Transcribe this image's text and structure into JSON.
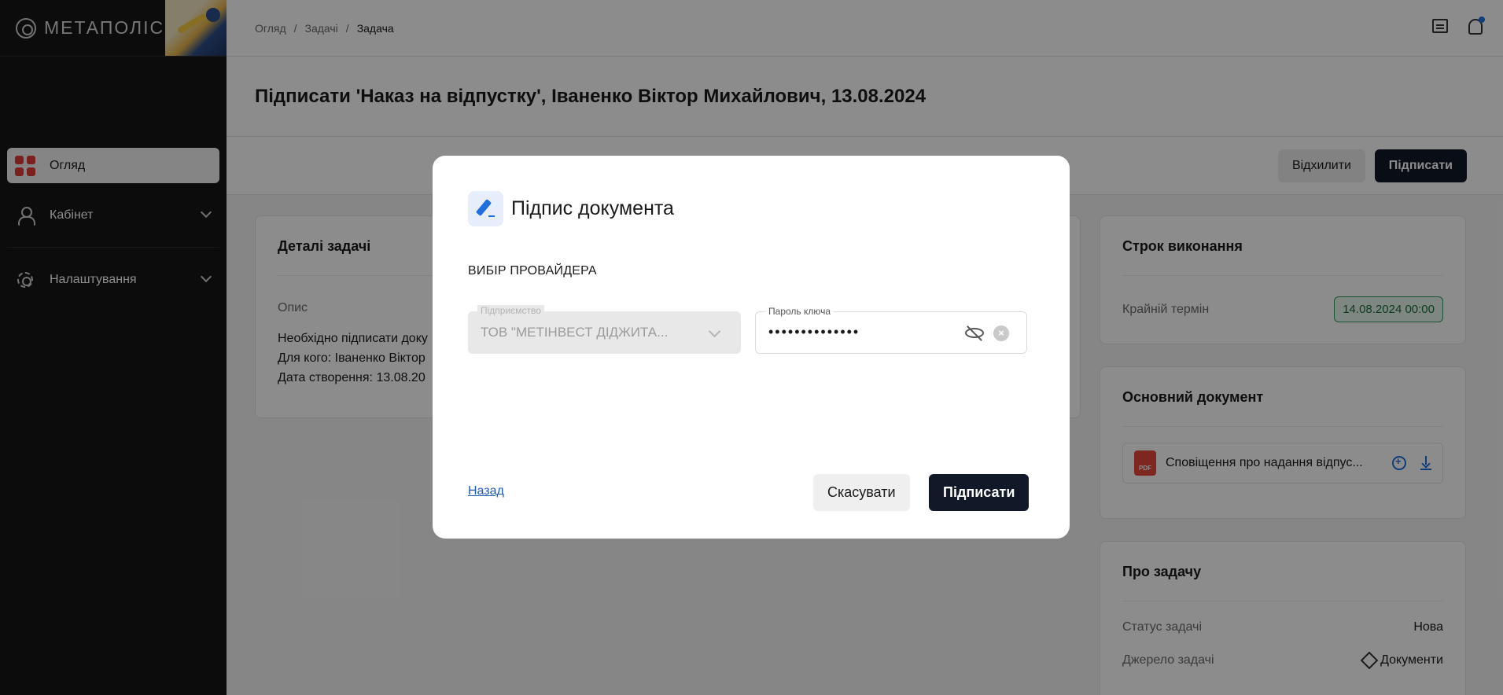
{
  "app": {
    "logo_text": "МЕТАПОЛІС"
  },
  "sidebar": {
    "items": [
      {
        "label": "Огляд",
        "icon": "dashboard-grid-icon",
        "active": true
      },
      {
        "label": "Кабінет",
        "icon": "user-icon",
        "expandable": true
      },
      {
        "label": "Налаштування",
        "icon": "gear-icon",
        "expandable": true
      }
    ]
  },
  "header": {
    "breadcrumb": [
      "Огляд",
      "Задачі",
      "Задача"
    ],
    "icons": [
      "chat-icon",
      "bell-icon"
    ]
  },
  "page": {
    "title": "Підписати 'Наказ на відпустку', Іваненко Віктор Михайлович, 13.08.2024",
    "reject_label": "Відхилити",
    "sign_label": "Підписати"
  },
  "details": {
    "title": "Деталі задачі",
    "desc_label": "Опис",
    "lines": [
      "Необхідно підписати доку",
      "Для кого: Іваненко Віктор",
      "Дата створення: 13.08.20"
    ]
  },
  "deadline": {
    "title": "Строк виконання",
    "label": "Крайній термін",
    "value": "14.08.2024 00:00"
  },
  "main_document": {
    "title": "Основний документ",
    "file_name": "Сповіщення про надання відпус...",
    "file_type": "PDF"
  },
  "about": {
    "title": "Про задачу",
    "status_label": "Статус задачі",
    "status_value": "Нова",
    "source_label": "Джерело задачі",
    "source_value": "Документи"
  },
  "modal": {
    "title": "Підпис документа",
    "section_label": "ВИБІР ПРОВАЙДЕРА",
    "company_label": "Підприємство",
    "company_value": "ТОВ \"МЕТІНВЕСТ ДІДЖИТА...",
    "password_label": "Пароль ключа",
    "password_value": "••••••••••••••",
    "back_label": "Назад",
    "cancel_label": "Скасувати",
    "confirm_label": "Підписати"
  },
  "colors": {
    "sidebar_bg": "#161616",
    "accent_dark": "#111827",
    "accent_blue": "#1f6fe0",
    "deadline_green": "#2e9c5b",
    "pdf_red": "#e5483d"
  }
}
